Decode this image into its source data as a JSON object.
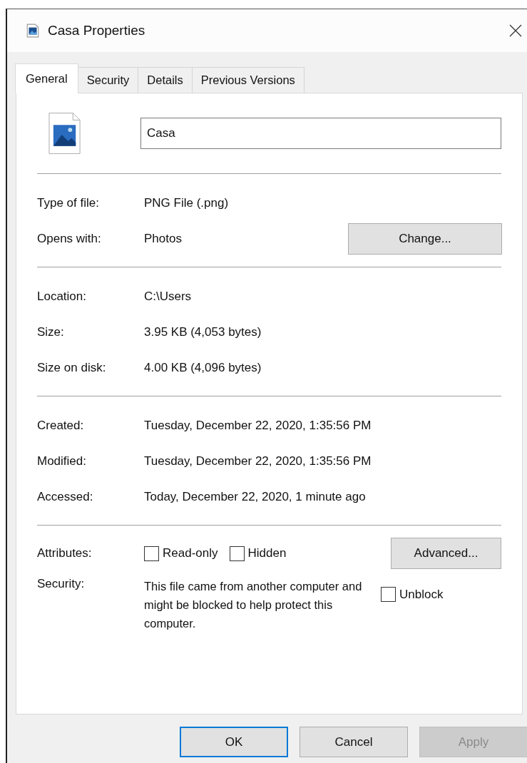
{
  "window": {
    "title": "Casa Properties"
  },
  "tabs": [
    {
      "label": "General",
      "selected": true
    },
    {
      "label": "Security",
      "selected": false
    },
    {
      "label": "Details",
      "selected": false
    },
    {
      "label": "Previous Versions",
      "selected": false
    }
  ],
  "file_name": {
    "value": "Casa"
  },
  "sections": [
    [
      {
        "label": "Type of file:",
        "value": "PNG File (.png)"
      },
      {
        "label": "Opens with:",
        "value": "Photos",
        "button": "Change..."
      }
    ],
    [
      {
        "label": "Location:",
        "value": "C:\\Users"
      },
      {
        "label": "Size:",
        "value": "3.95 KB (4,053 bytes)"
      },
      {
        "label": "Size on disk:",
        "value": "4.00 KB (4,096 bytes)"
      }
    ],
    [
      {
        "label": "Created:",
        "value": "Tuesday, December 22, 2020, 1:35:56 PM"
      },
      {
        "label": "Modified:",
        "value": "Tuesday, December 22, 2020, 1:35:56 PM"
      },
      {
        "label": "Accessed:",
        "value": "Today, December 22, 2020, 1 minute ago"
      }
    ]
  ],
  "attributes": {
    "label": "Attributes:",
    "checkboxes": [
      {
        "label": "Read-only",
        "checked": false
      },
      {
        "label": "Hidden",
        "checked": false
      }
    ],
    "button": "Advanced..."
  },
  "security": {
    "label": "Security:",
    "text": "This file came from another computer and might be blocked to help protect this computer.",
    "checkbox": {
      "label": "Unblock",
      "checked": false
    }
  },
  "buttons": [
    {
      "label": "OK",
      "default": true,
      "disabled": false
    },
    {
      "label": "Cancel",
      "default": false,
      "disabled": false
    },
    {
      "label": "Apply",
      "default": false,
      "disabled": true
    }
  ]
}
